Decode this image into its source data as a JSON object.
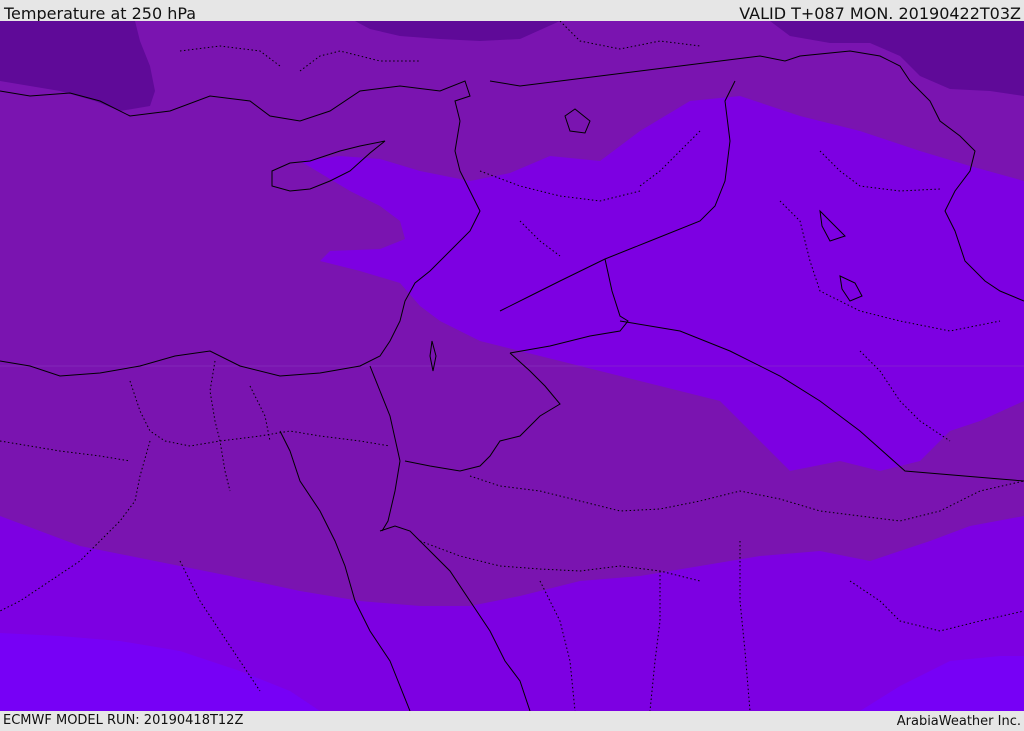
{
  "header": {
    "title": "Temperature at 250 hPa",
    "valid": "VALID T+087 MON. 20190422T03Z"
  },
  "footer": {
    "model_run": "ECMWF MODEL RUN: 20190418T12Z",
    "credit": "ArabiaWeather Inc."
  },
  "colors": {
    "band_coldest": "#5f0a98",
    "band_cold": "#7710b8",
    "band_mid": "#7d00e2",
    "band_warm": "#7700f6",
    "border_line": "#000000",
    "bar_background": "#e6e6e6"
  }
}
